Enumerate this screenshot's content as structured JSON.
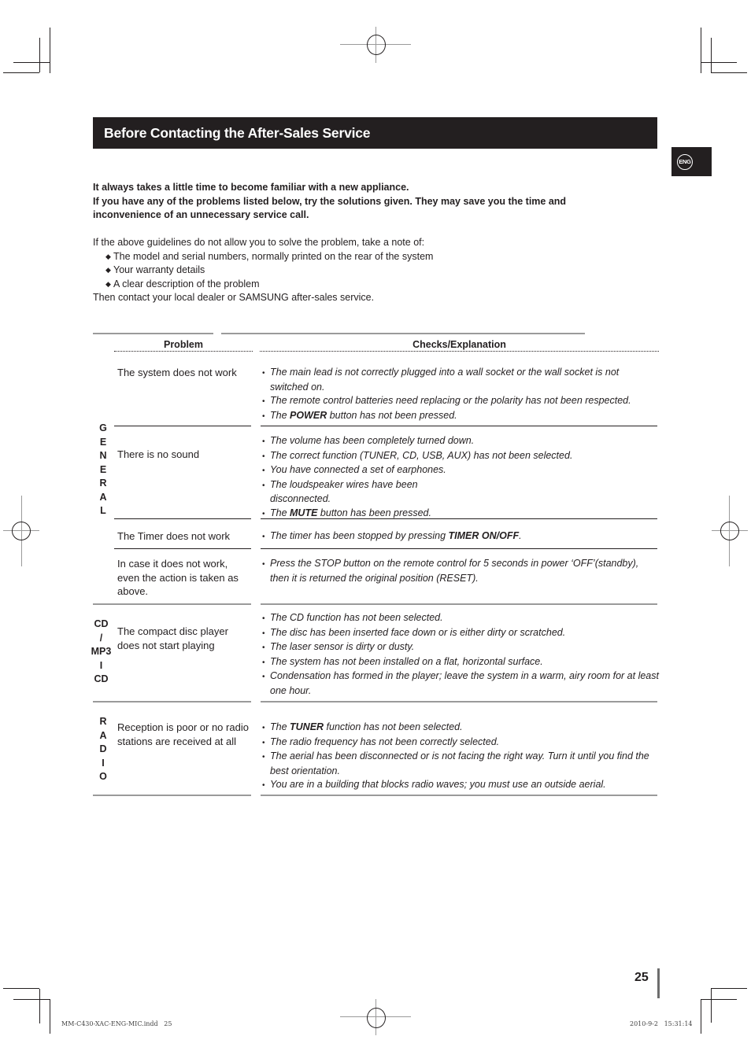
{
  "header": {
    "title": "Before Contacting the After-Sales Service",
    "language_badge": "ENG"
  },
  "intro": {
    "bold_lines": [
      "It always takes a little time to become familiar with a new appliance.",
      "If you have any of the problems listed below, try the solutions given. They may save you the time and",
      "inconvenience of an unnecessary service call."
    ],
    "note_lead": "If the above guidelines do not allow you to solve the problem, take a note of:",
    "note_items": [
      "The model and serial numbers, normally printed on the rear of the system",
      "Your warranty details",
      "A clear description of the problem"
    ],
    "closing": "Then contact your local dealer or SAMSUNG after-sales service."
  },
  "table": {
    "headers": {
      "problem": "Problem",
      "checks": "Checks/Explanation"
    },
    "categories": [
      {
        "label": [
          "G",
          "E",
          "N",
          "E",
          "R",
          "A",
          "L"
        ]
      },
      {
        "label": [
          "CD",
          "/",
          "MP3",
          "I",
          "CD"
        ]
      },
      {
        "label": [
          "R",
          "A",
          "D",
          "I",
          "O"
        ]
      }
    ],
    "rows": [
      {
        "problem": "The system does not work",
        "checks": [
          "The main lead is not correctly plugged into a wall socket or the wall socket is not switched on.",
          "The remote control batteries need replacing or the polarity has not been respected.",
          {
            "pre": "The ",
            "bold": "POWER",
            "post": " button has not been pressed."
          }
        ]
      },
      {
        "problem": "There is no sound",
        "checks": [
          "The volume has been completely turned down.",
          "The correct function (TUNER, CD, USB, AUX) has not been selected.",
          "You have connected a set of earphones.",
          "The loudspeaker wires have been disconnected.",
          {
            "pre": "The ",
            "bold": "MUTE",
            "post": " button has been pressed."
          }
        ]
      },
      {
        "problem": "The Timer does not work",
        "checks": [
          {
            "pre": "The timer has been stopped by pressing ",
            "bold": "TIMER ON/OFF",
            "post": "."
          }
        ]
      },
      {
        "problem": "In case it does not work, even the action is taken as above.",
        "checks": [
          "Press the STOP  button on the remote control for 5 seconds in power ‘OFF’(standby), then it is returned the original position (RESET)."
        ]
      },
      {
        "problem": "The compact disc player does not start playing",
        "checks": [
          "The CD function has not been selected.",
          "The disc has been inserted face down or is either dirty or scratched.",
          "The laser sensor is dirty or dusty.",
          "The system has not been installed on a flat, horizontal surface.",
          "Condensation has formed in the player; leave the system in a warm, airy room for at least one hour."
        ]
      },
      {
        "problem": "Reception is poor or no radio stations are received at all",
        "checks": [
          {
            "pre": "The ",
            "bold": "TUNER",
            "post": " function has not been selected."
          },
          "The radio frequency has not been correctly selected.",
          "The aerial has been disconnected or is not facing the right way. Turn it until you find the best orientation.",
          "You are in a building that blocks radio waves; you must use an outside aerial."
        ]
      }
    ]
  },
  "footer": {
    "page_number": "25",
    "slug_file": "MM-C430-XAC-ENG-MIC.indd   25",
    "slug_date": "2010-9-2   15:31:14"
  }
}
